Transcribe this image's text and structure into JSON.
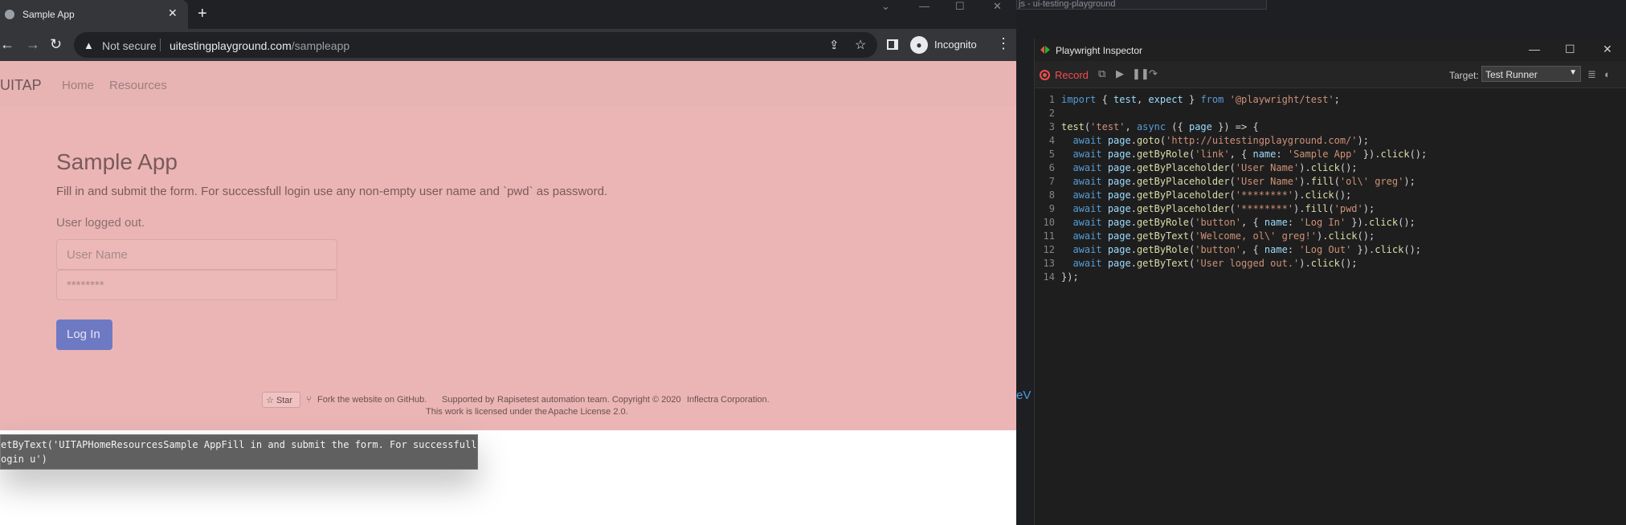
{
  "browser": {
    "tab_title": "Sample App",
    "tab_close": "✕",
    "new_tab": "+",
    "window_controls": [
      "⌄",
      "—",
      "☐",
      "✕"
    ],
    "security_label": "Not secure",
    "url_host": "uitestingplayground.com",
    "url_path": "/sampleapp",
    "incognito_label": "Incognito"
  },
  "page": {
    "brand": "UITAP",
    "nav": [
      "Home",
      "Resources"
    ],
    "heading": "Sample App",
    "description": "Fill in and submit the form. For successfull login use any non-empty user name and `pwd` as password.",
    "status": "User logged out.",
    "username_placeholder": "User Name",
    "password_placeholder": "********",
    "login_button": "Log In",
    "footer": {
      "star": "☆ Star",
      "fork": "Fork the website on GitHub.",
      "supported_prefix": "Supported by",
      "rapise": "Rapise",
      "supported_suffix": "test automation team. Copyright © 2020",
      "inflectra": "Inflectra Corporation.",
      "license_prefix": "This work is licensed under the",
      "license_link": "Apache License 2.0."
    }
  },
  "tooltip": {
    "line1": "etByText('UITAPHomeResourcesSample AppFill in and submit the form. For successfull",
    "line2": "ogin u')"
  },
  "background": {
    "tab_text": "js - ui-testing-playground",
    "code_fragment": "eV"
  },
  "inspector": {
    "title": "Playwright Inspector",
    "record_label": "Record",
    "target_label": "Target:",
    "target_value": "Test Runner",
    "line_numbers": [
      "1",
      "2",
      "3",
      "4",
      "5",
      "6",
      "7",
      "8",
      "9",
      "10",
      "11",
      "12",
      "13",
      "14"
    ],
    "code_strings": {
      "import_src": "'@playwright/test'",
      "test_name": "'test'",
      "goto_url": "'http://uitestingplayground.com/'",
      "role_link": "'link'",
      "name_sample": "'Sample App'",
      "ph_user": "'User Name'",
      "fill_user": "'ol\\' greg'",
      "ph_pwd": "'********'",
      "fill_pwd": "'pwd'",
      "role_button": "'button'",
      "name_login": "'Log In'",
      "text_welcome": "'Welcome, ol\\' greg!'",
      "name_logout": "'Log Out'",
      "text_logged_out": "'User logged out.'"
    }
  }
}
